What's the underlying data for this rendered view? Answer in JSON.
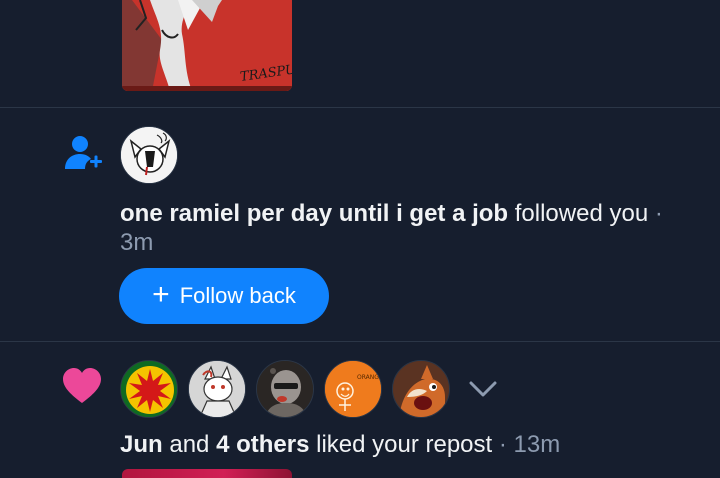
{
  "follow_notification": {
    "user_name": "one ramiel per day until i get a job",
    "action_text": " followed you",
    "separator": " · ",
    "time": "3m",
    "follow_back_label": "Follow back",
    "follow_back_icon": "plus-icon",
    "icon": "person-add-icon",
    "icon_color": "#1083fe"
  },
  "like_notification": {
    "user_name": "Jun",
    "connector": " and ",
    "others_count_text": "4 others",
    "action_text": " liked your repost",
    "separator": " · ",
    "time": "13m",
    "icon": "heart-icon",
    "icon_color": "#ec4899",
    "expand_icon": "chevron-down-icon"
  },
  "colors": {
    "background": "#161e2e",
    "divider": "#2b3647",
    "text": "#f1f3f5",
    "muted": "#8d9bb0",
    "accent": "#1083fe"
  }
}
